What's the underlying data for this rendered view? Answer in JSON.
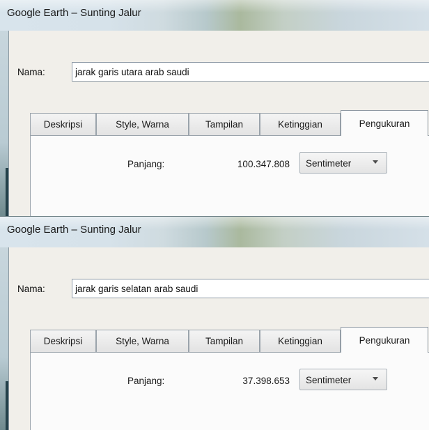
{
  "dialogs": [
    {
      "title": "Google Earth – Sunting Jalur",
      "name_label": "Nama:",
      "name_value": "jarak garis utara arab saudi",
      "tabs": [
        {
          "label": "Deskripsi"
        },
        {
          "label": "Style, Warna"
        },
        {
          "label": "Tampilan"
        },
        {
          "label": "Ketinggian"
        },
        {
          "label": "Pengukuran"
        }
      ],
      "active_tab": "Pengukuran",
      "measurement_label": "Panjang:",
      "measurement_value": "100.347.808",
      "unit": "Sentimeter"
    },
    {
      "title": "Google Earth – Sunting Jalur",
      "name_label": "Nama:",
      "name_value": "jarak garis selatan arab saudi",
      "tabs": [
        {
          "label": "Deskripsi"
        },
        {
          "label": "Style, Warna"
        },
        {
          "label": "Tampilan"
        },
        {
          "label": "Ketinggian"
        },
        {
          "label": "Pengukuran"
        }
      ],
      "active_tab": "Pengukuran",
      "measurement_label": "Panjang:",
      "measurement_value": "37.398.653",
      "unit": "Sentimeter"
    }
  ],
  "icons": {
    "dropdown": "chevron-down-icon"
  }
}
